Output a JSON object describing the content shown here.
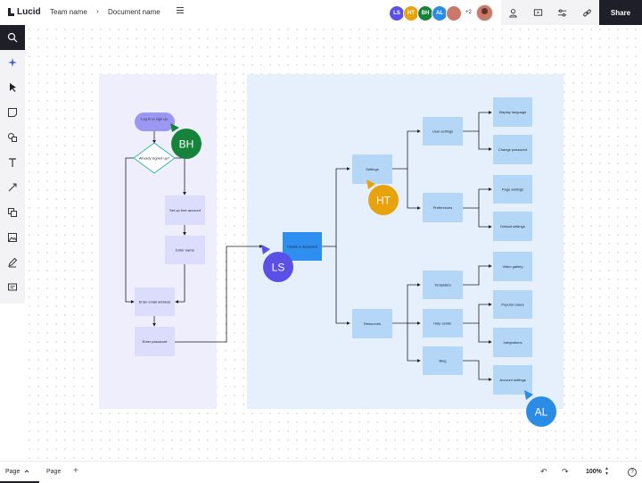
{
  "header": {
    "logo": "Lucid",
    "team_name": "Team name",
    "separator": "›",
    "document_name": "Document name",
    "collaborators": [
      {
        "initials": "LS",
        "color": "#5b50e6"
      },
      {
        "initials": "HT",
        "color": "#e7a20c"
      },
      {
        "initials": "BH",
        "color": "#16833a"
      },
      {
        "initials": "AL",
        "color": "#2b8ce6"
      }
    ],
    "more_collaborators": "+2",
    "share_label": "Share"
  },
  "diagram": {
    "nodes": {
      "login": "Log in or sign up",
      "signed_up": "Already signed up?",
      "set_up_account": "Set up free account",
      "enter_name": "Enter name",
      "enter_email": "Enter email address",
      "enter_password": "Enter password",
      "create_doc": "Create a document",
      "settings": "Settings",
      "resources": "Resources",
      "user_settings": "User settings",
      "preferences": "Preferences",
      "display_language": "Display language",
      "change_password": "Change password",
      "page_settings": "Page settings",
      "default_settings": "Default settings",
      "templates": "Templates",
      "help_center": "Help center",
      "blog": "Blog",
      "video_gallery": "Video gallery",
      "popular_cases": "Popular cases",
      "integrations": "Integrations",
      "account_settings": "Account settings"
    },
    "cursors": [
      {
        "initials": "BH",
        "color": "#16833a"
      },
      {
        "initials": "HT",
        "color": "#e7a20c"
      },
      {
        "initials": "LS",
        "color": "#5b50e6"
      },
      {
        "initials": "AL",
        "color": "#2b8ce6"
      }
    ]
  },
  "footer": {
    "active_page": "Page",
    "page2": "Page",
    "add": "+",
    "zoom": "100%",
    "help": "?"
  }
}
